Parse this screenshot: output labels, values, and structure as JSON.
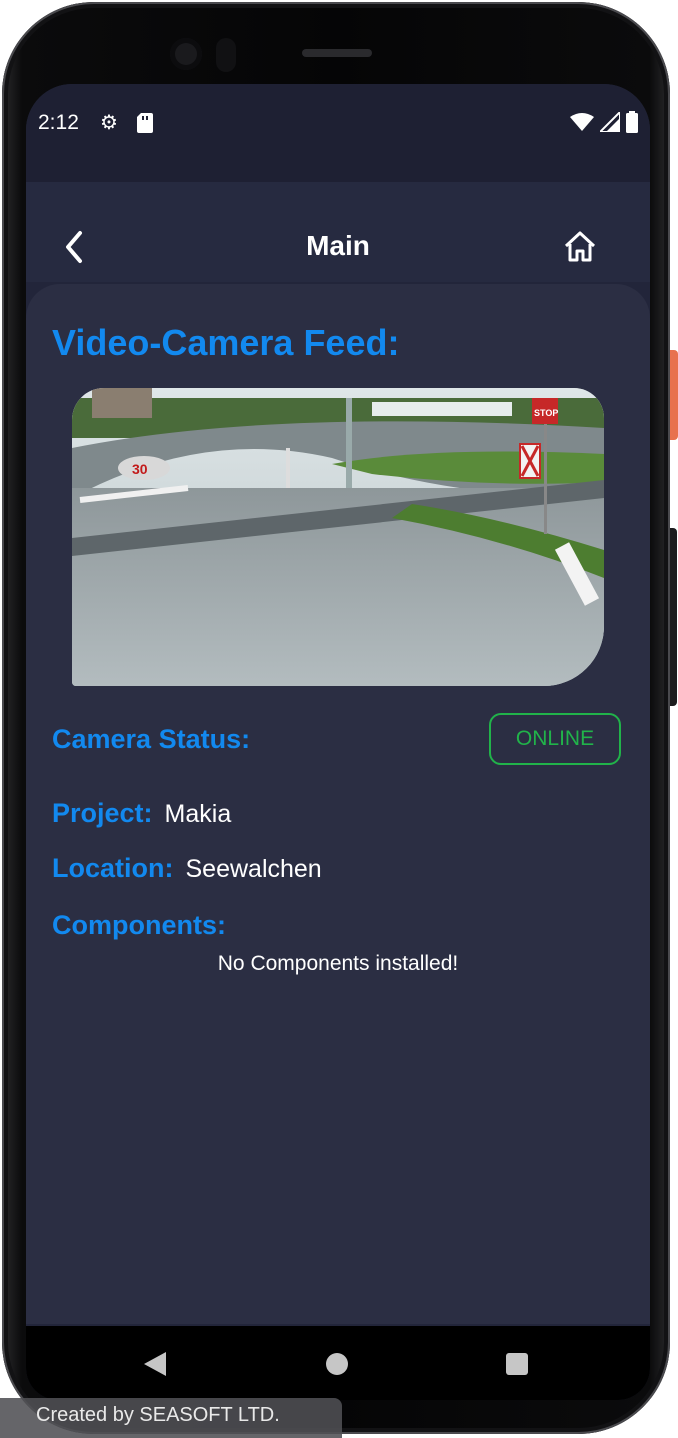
{
  "status_bar": {
    "time": "2:12",
    "left_icons": [
      "gear-icon",
      "sd-card-icon"
    ],
    "right_icons": [
      "wifi-icon",
      "cell-signal-icon",
      "battery-icon"
    ]
  },
  "app_bar": {
    "title": "Main",
    "back_icon": "chevron-left-icon",
    "home_icon": "home-icon"
  },
  "content": {
    "feed_heading": "Video-Camera Feed:",
    "camera_status_label": "Camera Status:",
    "camera_status_value": "ONLINE",
    "project_label": "Project:",
    "project_value": "Makia",
    "location_label": "Location:",
    "location_value": "Seewalchen",
    "components_label": "Components:",
    "components_empty": "No Components installed!"
  },
  "nav_bar": {
    "icons": [
      "back-triangle-icon",
      "home-circle-icon",
      "recents-square-icon"
    ]
  },
  "watermark": {
    "text": "Created by SEASOFT LTD."
  },
  "colors": {
    "accent": "#1289ef",
    "online": "#21b34a",
    "background": "#22253a",
    "card": "#2b2e43"
  }
}
